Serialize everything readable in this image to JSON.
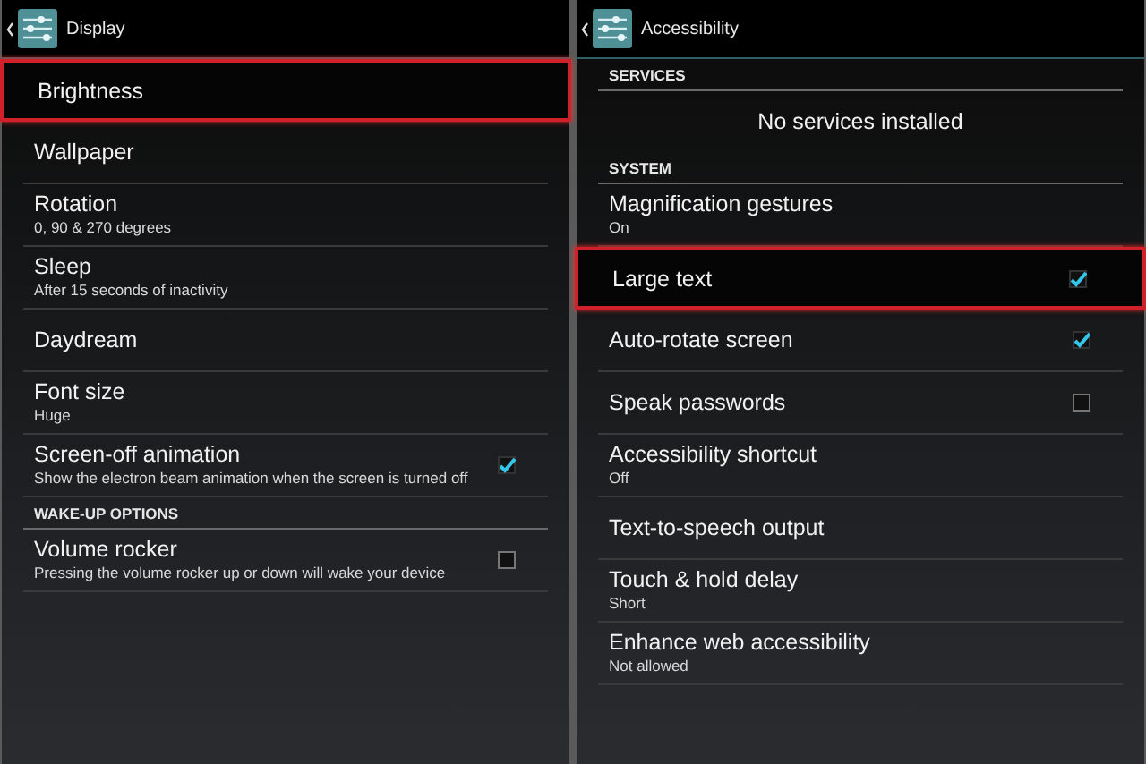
{
  "panels": [
    {
      "title": "Display",
      "items": [
        {
          "kind": "item",
          "title": "Brightness",
          "highlighted": true
        },
        {
          "kind": "item",
          "title": "Wallpaper",
          "highlighted": false
        },
        {
          "kind": "item",
          "title": "Rotation",
          "summary": "0, 90 & 270 degrees",
          "highlighted": false
        },
        {
          "kind": "item",
          "title": "Sleep",
          "summary": "After 15 seconds of inactivity",
          "highlighted": false
        },
        {
          "kind": "item",
          "title": "Daydream",
          "highlighted": false
        },
        {
          "kind": "item",
          "title": "Font size",
          "summary": "Huge",
          "highlighted": false
        },
        {
          "kind": "checkbox",
          "title": "Screen-off animation",
          "summary": "Show the electron beam animation when the screen is turned off",
          "checked": true,
          "highlighted": false
        },
        {
          "kind": "category",
          "title": "WAKE-UP OPTIONS"
        },
        {
          "kind": "checkbox",
          "title": "Volume rocker",
          "summary": "Pressing the volume rocker up or down will wake your device",
          "checked": false,
          "highlighted": false
        }
      ]
    },
    {
      "title": "Accessibility",
      "items": [
        {
          "kind": "category",
          "title": "SERVICES"
        },
        {
          "kind": "message",
          "title": "No services installed"
        },
        {
          "kind": "category",
          "title": "SYSTEM"
        },
        {
          "kind": "item",
          "title": "Magnification gestures",
          "summary": "On",
          "highlighted": false
        },
        {
          "kind": "checkbox",
          "title": "Large text",
          "checked": true,
          "highlighted": true
        },
        {
          "kind": "checkbox",
          "title": "Auto-rotate screen",
          "checked": true,
          "highlighted": false
        },
        {
          "kind": "checkbox",
          "title": "Speak passwords",
          "checked": false,
          "highlighted": false
        },
        {
          "kind": "item",
          "title": "Accessibility shortcut",
          "summary": "Off",
          "highlighted": false
        },
        {
          "kind": "item",
          "title": "Text-to-speech output",
          "highlighted": false
        },
        {
          "kind": "item",
          "title": "Touch & hold delay",
          "summary": "Short",
          "highlighted": false
        },
        {
          "kind": "item",
          "title": "Enhance web accessibility",
          "summary": "Not allowed",
          "highlighted": false
        }
      ]
    }
  ]
}
